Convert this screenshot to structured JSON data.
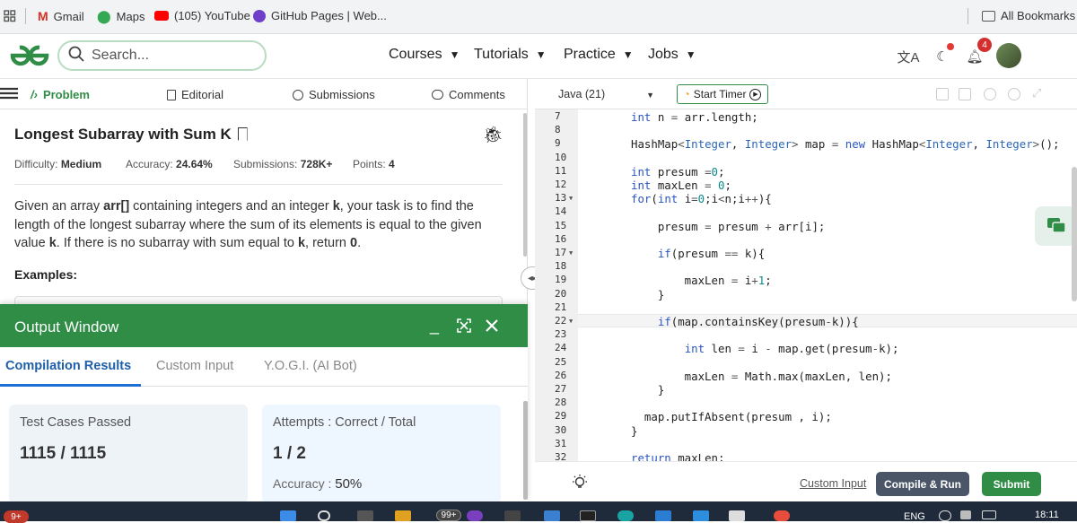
{
  "bookmarks": {
    "items": [
      "Gmail",
      "Maps",
      "(105) YouTube",
      "GitHub Pages | Web..."
    ],
    "all_bookmarks": "All Bookmarks"
  },
  "header": {
    "search_placeholder": "Search...",
    "nav": [
      "Courses",
      "Tutorials",
      "Practice",
      "Jobs"
    ],
    "notif_count": "4"
  },
  "problem_tabs": [
    "Problem",
    "Editorial",
    "Submissions",
    "Comments"
  ],
  "problem": {
    "title": "Longest Subarray with Sum K",
    "difficulty_label": "Difficulty:",
    "difficulty": "Medium",
    "accuracy_label": "Accuracy:",
    "accuracy": "24.64%",
    "submissions_label": "Submissions:",
    "submissions": "728K+",
    "points_label": "Points:",
    "points": "4",
    "desc_1": "Given an array ",
    "desc_arr": "arr[]",
    "desc_2": " containing integers and an integer ",
    "desc_k1": "k",
    "desc_3": ", your task is to find the length of the longest subarray where the sum of its elements is equal to the given value ",
    "desc_k2": "k",
    "desc_4": ". If there is no subarray with sum equal to ",
    "desc_k3": "k",
    "desc_5": ", return ",
    "desc_zero": "0",
    "desc_6": ".",
    "examples": "Examples:"
  },
  "output_window": {
    "title": "Output Window",
    "tabs": [
      "Compilation Results",
      "Custom Input",
      "Y.O.G.I. (AI Bot)"
    ],
    "tests_label": "Test Cases Passed",
    "tests_value": "1115 / 1115",
    "attempts_label": "Attempts : Correct / Total",
    "attempts_value": "1 / 2",
    "accuracy_label": "Accuracy :",
    "accuracy_value": "50%"
  },
  "editor": {
    "language": "Java (21)",
    "timer_label": "Start Timer",
    "line_numbers": [
      "7",
      "8",
      "9",
      "10",
      "11",
      "12",
      "13",
      "14",
      "15",
      "16",
      "17",
      "18",
      "19",
      "20",
      "21",
      "22",
      "23",
      "24",
      "25",
      "26",
      "27",
      "28",
      "29",
      "30",
      "31",
      "32"
    ],
    "folded_lines": [
      "13",
      "17",
      "22"
    ],
    "code": [
      "int n = arr.length;",
      "",
      "HashMap<Integer, Integer> map = new HashMap<Integer, Integer>();",
      "",
      "int presum =0;",
      "int maxLen = 0;",
      "for(int i=0;i<n;i++){",
      "",
      "    presum = presum + arr[i];",
      "",
      "    if(presum == k){",
      "",
      "        maxLen = i+1;",
      "    }",
      "",
      "    if(map.containsKey(presum-k)){",
      "",
      "        int len = i - map.get(presum-k);",
      "",
      "        maxLen = Math.max(maxLen, len);",
      "    }",
      "",
      "  map.putIfAbsent(presum , i);",
      "}",
      "",
      "return maxLen;"
    ],
    "custom_input": "Custom Input",
    "compile_run": "Compile & Run",
    "submit": "Submit"
  },
  "taskbar": {
    "badge_left": "9+",
    "badge_mid": "99+",
    "lang": "ENG",
    "time": "18:11"
  },
  "colors": {
    "brand_green": "#2f8d46",
    "compile_bg": "#4a5568",
    "keyword": "#2a55c4",
    "number": "#0b8a8a"
  }
}
